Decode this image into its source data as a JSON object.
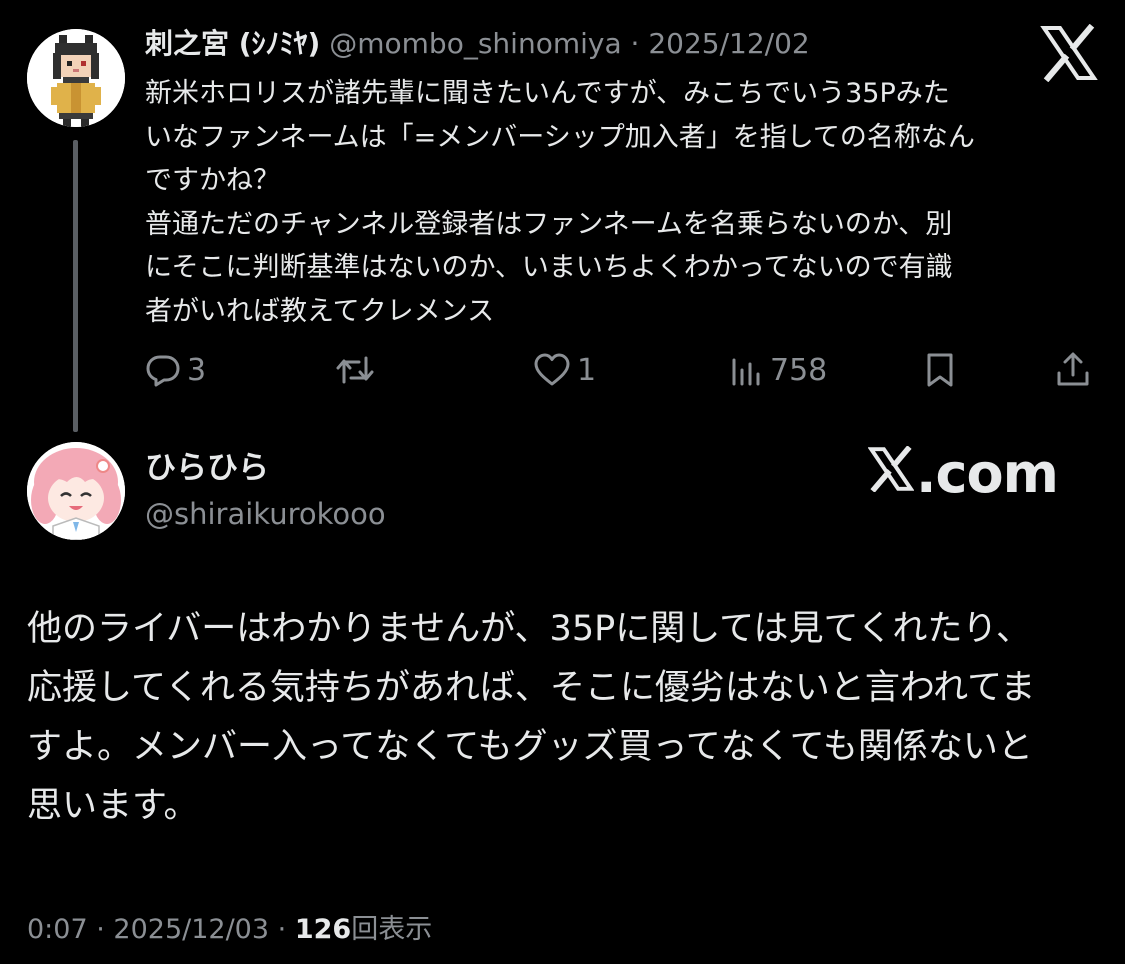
{
  "tweet1": {
    "display_name": "刺之宮 (ｼﾉﾐﾔ)",
    "handle": "@mombo_shinomiya",
    "separator": "·",
    "date": "2025/12/02",
    "text": "新米ホロリスが諸先輩に聞きたいんですが、みこちでいう35Pみた\nいなファンネームは「=メンバーシップ加入者」を指しての名称なん\nですかね？\n普通ただのチャンネル登録者はファンネームを名乗らないのか、別\nにそこに判断基準はないのか、いまいちよくわかってないので有識\n者がいれば教えてクレメンス",
    "actions": {
      "reply_count": "3",
      "retweet_count": "",
      "like_count": "1",
      "views_count": "758"
    },
    "icons": {
      "reply": "reply-icon",
      "retweet": "retweet-icon",
      "like": "heart-icon",
      "views": "views-icon",
      "bookmark": "bookmark-icon",
      "share": "share-icon"
    }
  },
  "tweet2": {
    "display_name": "ひらひら",
    "handle": "@shiraikurokooo",
    "text": "他のライバーはわかりませんが、35Pに関しては見てくれたり、\n応援してくれる気持ちがあれば、そこに優劣はないと言われてま\nすよ。メンバー入ってなくてもグッズ買ってなくても関係ないと\n思います。",
    "meta": {
      "time": "0:07",
      "separator1": "·",
      "date": "2025/12/03",
      "separator2": "·",
      "views_count": "126",
      "views_label": "回表示"
    }
  },
  "branding": {
    "x_logo": "x-logo-icon",
    "watermark_suffix": ".com"
  },
  "colors": {
    "background": "#000000",
    "primary_text": "#e7e9ea",
    "secondary_text": "#8b8f94",
    "thread_line": "#5a5e63"
  }
}
